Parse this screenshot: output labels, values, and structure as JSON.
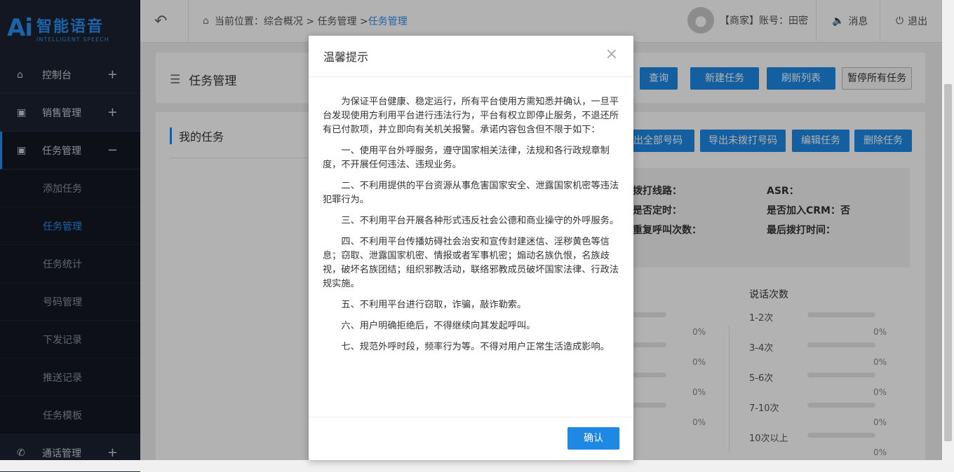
{
  "logo": {
    "ai": "Ai",
    "cn": "智能语音",
    "en": "INTELLIGENT SPEECH"
  },
  "sidebar": {
    "items": [
      {
        "label": "控制台",
        "sign": "+"
      },
      {
        "label": "销售管理",
        "sign": "+"
      },
      {
        "label": "任务管理",
        "sign": "−"
      }
    ],
    "sub": [
      "添加任务",
      "任务管理",
      "任务统计",
      "号码管理",
      "下发记录",
      "推送记录",
      "任务模板"
    ],
    "bottom": {
      "label": "通话管理",
      "sign": "+"
    }
  },
  "header": {
    "breadcrumb_prefix": "当前位置：综合概况 > 任务管理 > ",
    "breadcrumb_current": "任务管理",
    "user": "【商家】账号：田密",
    "messages": "消息",
    "logout": "退出"
  },
  "panel": {
    "title": "任务管理",
    "buttons": [
      "查询",
      "新建任务",
      "刷新列表",
      "暂停所有任务"
    ],
    "my_tasks": "我的任务",
    "task_buttons": [
      "导出全部号码",
      "导出未拨打号码",
      "编辑任务",
      "删除任务"
    ],
    "info": {
      "dial_line": "拨打线路：",
      "asr": "ASR：",
      "timed": "是否定时：",
      "crm": "是否加入CRM：否",
      "repeat": "重复呼叫次数：",
      "last_call": "最后拨打时间："
    },
    "talk_title": "说话次数",
    "talk_rows": [
      {
        "label": "1-2次",
        "pct": "0%"
      },
      {
        "label": "3-4次",
        "pct": "0%"
      },
      {
        "label": "5-6次",
        "pct": "0%"
      },
      {
        "label": "7-10次",
        "pct": "0%"
      },
      {
        "label": "10次以上",
        "pct": "0%"
      }
    ],
    "left_pcts": [
      "0%",
      "0%",
      "0%",
      "0%"
    ]
  },
  "modal": {
    "title": "温馨提示",
    "close": "×",
    "paragraphs": [
      "为保证平台健康、稳定运行，所有平台使用方需知悉并确认，一旦平台发现使用方利用平台进行违法行为，平台有权立即停止服务，不退还所有已付款项，并立即向有关机关报警。承诺内容包含但不限于如下：",
      "一、使用平台外呼服务，遵守国家相关法律，法规和各行政规章制度，不开展任何违法、违规业务。",
      "二、不利用提供的平台资源从事危害国家安全、泄露国家机密等违法犯罪行为。",
      "三、不利用平台开展各种形式违反社会公德和商业操守的外呼服务。",
      "四、不利用平台传播妨碍社会治安和宣传封建迷信、淫秽黄色等信息；窃取、泄露国家机密、情报或者军事机密；煽动名族仇恨，名族歧视，破坏名族团结；组织邪教活动，联络邪教成员破坏国家法律、行政法规实施。",
      "五、不利用平台进行窃取，诈骗，敲诈勒索。",
      "六、用户明确拒绝后，不得继续向其发起呼叫。",
      "七、规范外呼时段，频率行为等。不得对用户正常生活造成影响。"
    ],
    "confirm": "确认"
  }
}
